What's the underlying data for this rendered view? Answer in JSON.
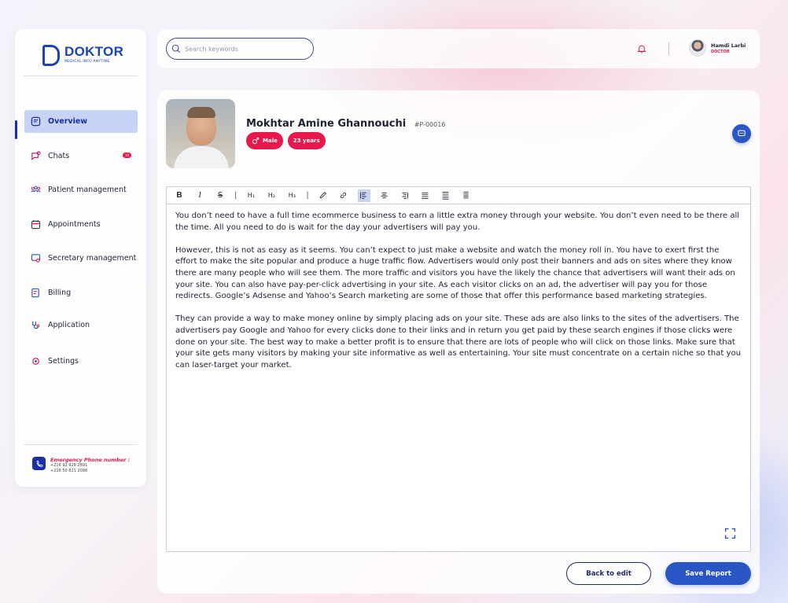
{
  "brand": {
    "name": "DOKTOR",
    "tagline": "MEDICAL INFO ANYTIME"
  },
  "sidebar": {
    "items": [
      {
        "label": "Overview",
        "icon": "overview-icon",
        "active": true
      },
      {
        "label": "Chats",
        "icon": "chat-icon",
        "badge": "10"
      },
      {
        "label": "Patient management",
        "icon": "patients-icon"
      },
      {
        "label": "Appointments",
        "icon": "calendar-icon"
      },
      {
        "label": "Secretary management",
        "icon": "secretary-icon"
      },
      {
        "label": "Billing",
        "icon": "billing-icon"
      },
      {
        "label": "Application",
        "icon": "application-icon"
      },
      {
        "label": "Settings",
        "icon": "settings-icon"
      }
    ],
    "emergency": {
      "label": "Emergency Phone number :",
      "numbers": [
        "+216 92 928 2891",
        "+216 50 821 2098"
      ]
    }
  },
  "header": {
    "search_placeholder": "Search keywords",
    "user": {
      "name": "Hamdi Larbi",
      "role": "DOCTOR"
    }
  },
  "patient": {
    "name": "Mokhtar Amine Ghannouchi",
    "id": "#P-00016",
    "gender": "Male",
    "age": "23 years"
  },
  "editor": {
    "toolbar": {
      "bold": "B",
      "italic": "I",
      "strike": "S",
      "h1": "H₁",
      "h2": "H₂",
      "h3": "H₃"
    },
    "paragraphs": [
      "You don’t need to have a full time ecommerce business to earn a little extra money through your website. You don’t even need to be there all the time. All you need to do is wait for the day your advertisers will pay you.",
      "However, this is not as easy as it seems. You can’t expect to just make a website and watch the money roll in. You have to exert first the effort to make the site popular and produce a huge traffic flow. Advertisers would only post their banners and ads on sites where they know there are many people who will see them. The more traffic and visitors you have the likely the chance that advertisers will want their ads on your site. You can also have pay-per-click advertising in your site. As each visitor clicks on an ad, the advertiser will pay you for those redirects. Google’s Adsense and Yahoo’s Search marketing are some of those that offer this performance based marketing strategies.",
      "They can provide a way to make money online by simply placing ads on your site. These ads are also links to the sites of the advertisers. The advertisers pay Google and Yahoo for every clicks done to their links and in return you get paid by these search engines if those clicks were done on your site. The best way to make a better profit is to ensure that there are lots of people who will click on those links. Make sure that your site gets many visitors by making your site informative as well as entertaining. Your site must concentrate on a certain niche so that you can laser-target your market."
    ]
  },
  "actions": {
    "back_label": "Back to edit",
    "save_label": "Save Report"
  },
  "colors": {
    "primary": "#2956c4",
    "brand": "#1a43b5",
    "accent": "#e8174c",
    "active_bg": "#c6d3f5"
  }
}
